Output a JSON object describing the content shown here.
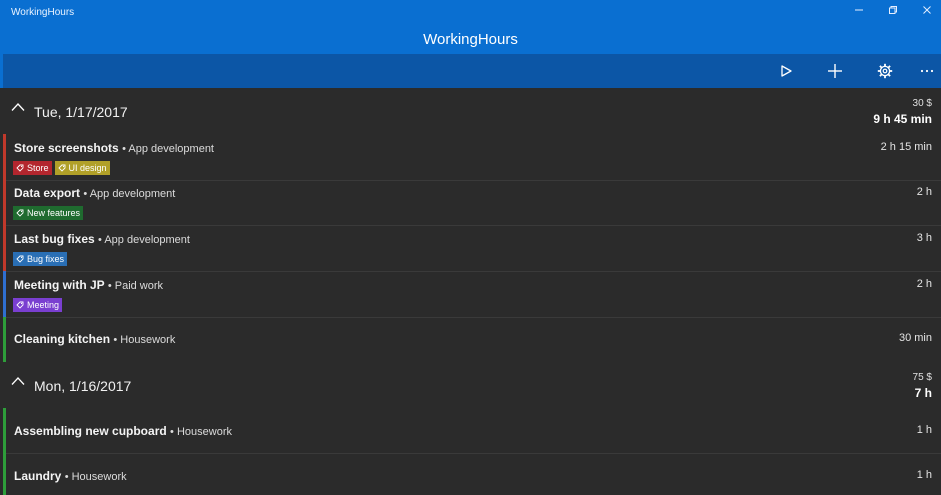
{
  "window": {
    "title": "WorkingHours",
    "controls": [
      "minimize",
      "restore",
      "close"
    ]
  },
  "header": {
    "title": "WorkingHours"
  },
  "toolbar": {
    "buttons": [
      {
        "name": "start",
        "icon": "play-icon"
      },
      {
        "name": "add",
        "icon": "plus-icon"
      },
      {
        "name": "settings",
        "icon": "gear-icon"
      },
      {
        "name": "more",
        "icon": "ellipsis-icon"
      }
    ]
  },
  "colors": {
    "accent": "#0a6fd1",
    "toolbar": "#0c56a6",
    "background": "#2b2b2b",
    "app_development": "#c0392b",
    "paid_work": "#2f6fd0",
    "housework": "#2e9e3a"
  },
  "groups": [
    {
      "date": "Tue, 1/17/2017",
      "money": "30 $",
      "total": "9 h 45 min",
      "entries": [
        {
          "name": "Store screenshots",
          "project": "App development",
          "duration": "2 h 15 min",
          "tags": [
            {
              "label": "Store",
              "color": "#b3262e"
            },
            {
              "label": "UI design",
              "color": "#b1a028"
            }
          ]
        },
        {
          "name": "Data export",
          "project": "App development",
          "duration": "2 h",
          "tags": [
            {
              "label": "New features",
              "color": "#1f6b2f"
            }
          ]
        },
        {
          "name": "Last bug fixes",
          "project": "App development",
          "duration": "3 h",
          "tags": [
            {
              "label": "Bug fixes",
              "color": "#2a6fb5"
            }
          ]
        },
        {
          "name": "Meeting with JP",
          "project": "Paid work",
          "duration": "2 h",
          "tags": [
            {
              "label": "Meeting",
              "color": "#7a3fd0"
            }
          ]
        },
        {
          "name": "Cleaning kitchen",
          "project": "Housework",
          "duration": "30 min",
          "tags": []
        }
      ]
    },
    {
      "date": "Mon, 1/16/2017",
      "money": "75 $",
      "total": "7 h",
      "entries": [
        {
          "name": "Assembling new cupboard",
          "project": "Housework",
          "duration": "1 h",
          "tags": []
        },
        {
          "name": "Laundry",
          "project": "Housework",
          "duration": "1 h",
          "tags": []
        }
      ]
    }
  ]
}
